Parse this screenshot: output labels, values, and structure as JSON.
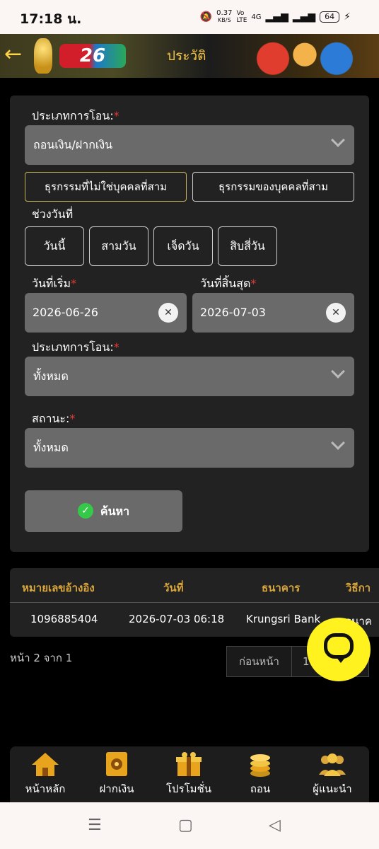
{
  "status_bar": {
    "time": "17:18 น.",
    "speed_value": "0.37",
    "speed_unit": "KB/S",
    "network": "4G",
    "battery": "64"
  },
  "header": {
    "title": "ประวัติ",
    "logo_text": "26"
  },
  "form": {
    "transfer_type_label": "ประเภทการโอน:",
    "transfer_type_value": "ถอนเงิน/ฝากเงิน",
    "tabs": [
      {
        "label": "ธุรกรรมที่ไม่ใช่บุคคลที่สาม",
        "active": true
      },
      {
        "label": "ธุรกรรมของบุคคลที่สาม",
        "active": false
      }
    ],
    "date_range_label": "ช่วงวันที่",
    "date_ranges": [
      "วันนี้",
      "สามวัน",
      "เจ็ดวัน",
      "สิบสี่วัน"
    ],
    "start_date_label": "วันที่เริ่ม",
    "start_date_value": "2026-06-26",
    "end_date_label": "วันที่สิ้นสุด",
    "end_date_value": "2026-07-03",
    "type_label": "ประเภทการโอน:",
    "type_value": "ทั้งหมด",
    "status_label": "สถานะ:",
    "status_value": "ทั้งหมด",
    "required_mark": "*",
    "search_label": "ค้นหา"
  },
  "table": {
    "headers": [
      "หมายเลขอ้างอิง",
      "วันที่",
      "ธนาคาร",
      "วิธีกา"
    ],
    "rows": [
      [
        "1096885404",
        "2026-07-03 06:18",
        "Krungsri Bank",
        "ธนาค"
      ]
    ]
  },
  "pagination": {
    "info": "หน้า 2 จาก 1",
    "prev_label": "ก่อนหน้า",
    "current_page": "1"
  },
  "bottom_nav": [
    {
      "label": "หน้าหลัก",
      "icon": "home-icon"
    },
    {
      "label": "ฝากเงิน",
      "icon": "safe-icon"
    },
    {
      "label": "โปรโมชั่น",
      "icon": "gift-icon"
    },
    {
      "label": "ถอน",
      "icon": "coins-icon"
    },
    {
      "label": "ผู้แนะนำ",
      "icon": "people-icon"
    }
  ],
  "colors": {
    "accent_gold": "#d9a63b",
    "required_red": "#e53935",
    "chat_yellow": "#fff21f",
    "success_green": "#35c94a"
  }
}
